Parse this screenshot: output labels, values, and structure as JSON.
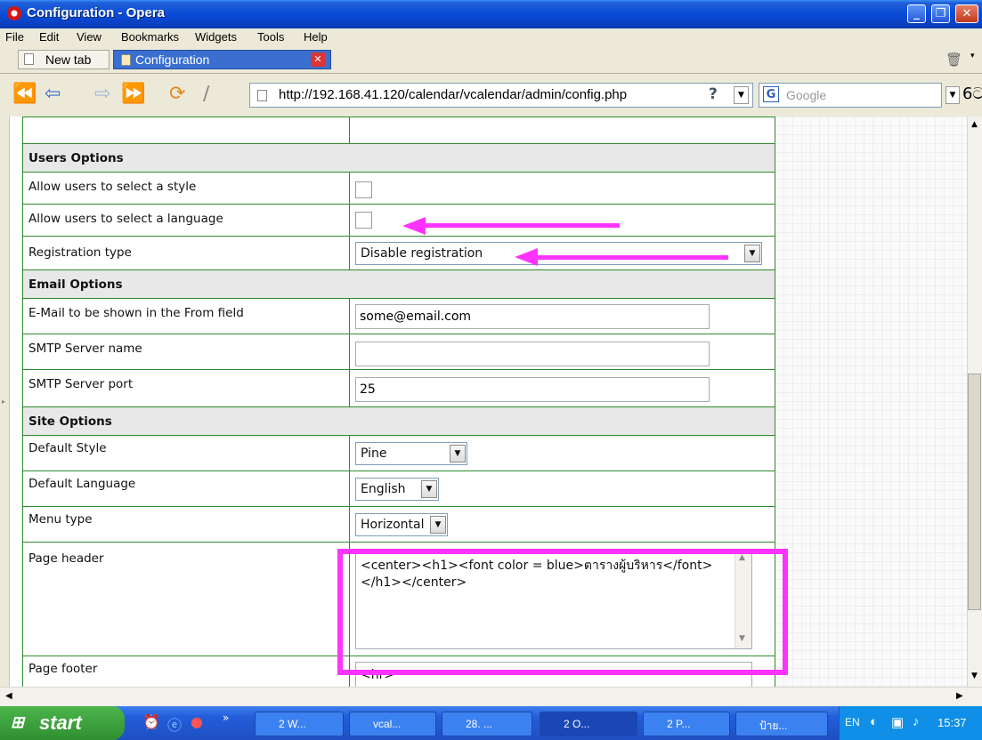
{
  "window": {
    "title": "Configuration - Opera"
  },
  "menu": [
    "File",
    "Edit",
    "View",
    "Bookmarks",
    "Widgets",
    "Tools",
    "Help"
  ],
  "tabs": [
    {
      "label": "New tab"
    },
    {
      "label": "Configuration"
    }
  ],
  "address": {
    "url": "http://192.168.41.120/calendar/vcalendar/admin/config.php"
  },
  "search": {
    "engine_label": "G",
    "placeholder": "Google"
  },
  "sections": {
    "users": "Users Options",
    "email": "Email Options",
    "site": "Site Options"
  },
  "fields": {
    "allow_style": {
      "label": "Allow users to select a style",
      "checked": false
    },
    "allow_language": {
      "label": "Allow users to select a language",
      "checked": false
    },
    "registration_type": {
      "label": "Registration type",
      "value": "Disable registration"
    },
    "from_email": {
      "label": "E-Mail to be shown in the From field",
      "value": "some@email.com"
    },
    "smtp_name": {
      "label": "SMTP Server name",
      "value": ""
    },
    "smtp_port": {
      "label": "SMTP Server port",
      "value": "25"
    },
    "default_style": {
      "label": "Default Style",
      "value": "Pine"
    },
    "default_language": {
      "label": "Default Language",
      "value": "English"
    },
    "menu_type": {
      "label": "Menu type",
      "value": "Horizontal"
    },
    "page_header": {
      "label": "Page header",
      "value": "<center><h1><font color = blue>ตารางผู้บริหาร</font></h1></center>"
    },
    "page_footer": {
      "label": "Page footer",
      "value": "<hr>"
    }
  },
  "taskbar": {
    "start": "start",
    "items": [
      "2 W...",
      "vcal...",
      "28. ...",
      "2 O...",
      "2 P...",
      "ป้าย..."
    ],
    "tray_lang": "EN",
    "clock": "15:37"
  },
  "colors": {
    "annotation": "#ff33ff",
    "table_border": "#2e8b2e"
  }
}
